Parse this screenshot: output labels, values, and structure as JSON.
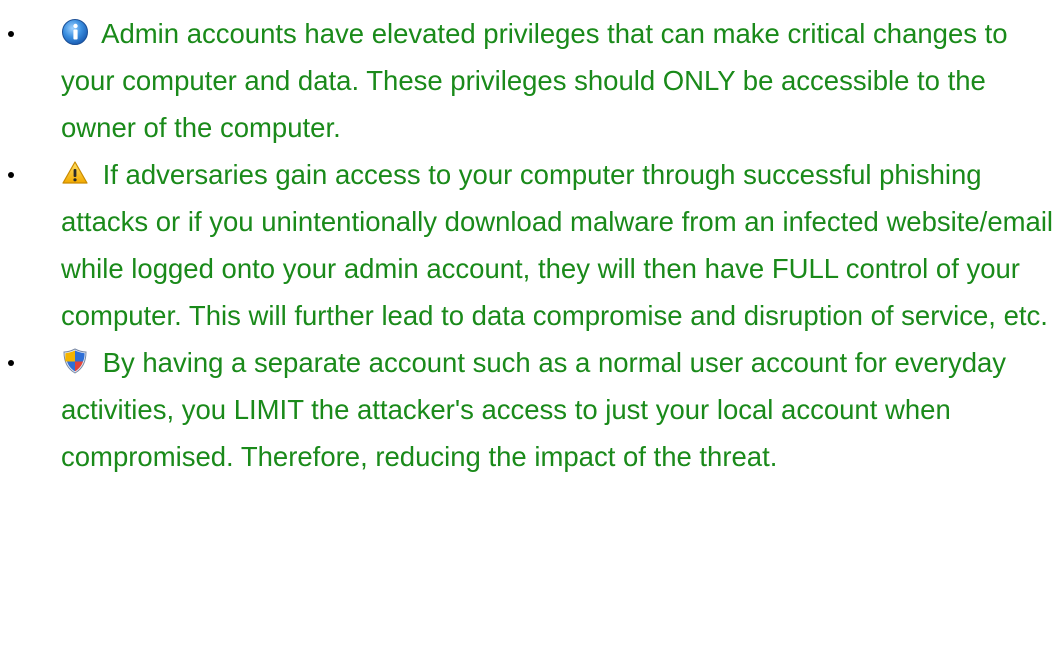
{
  "theme": {
    "text_color": "#1a8a1a"
  },
  "items": [
    {
      "icon": "info-icon",
      "text": "Admin accounts have elevated privileges that can make critical changes to your computer and data. These privileges should ONLY be accessible to the owner of the computer."
    },
    {
      "icon": "warning-icon",
      "text": "If adversaries gain access to your computer through successful phishing attacks or if you unintentionally download malware from an infected website/email while logged onto your admin account, they will then have FULL control of your computer. This will further lead to data compromise and disruption of service, etc."
    },
    {
      "icon": "security-shield-icon",
      "text": "By having a separate account such as a normal user account for everyday activities, you LIMIT the attacker's access to just your local account when compromised. Therefore, reducing the impact of the threat."
    }
  ]
}
